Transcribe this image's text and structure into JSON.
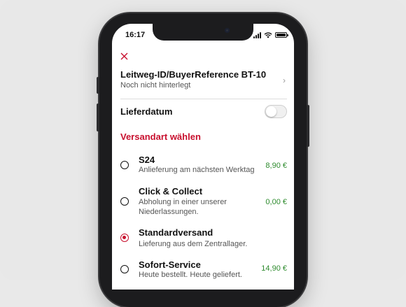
{
  "status_bar": {
    "time": "16:17"
  },
  "header": {
    "close_icon": "close-icon"
  },
  "leitweg": {
    "title": "Leitweg-ID/BuyerReference BT-10",
    "subtitle": "Noch nicht hinterlegt",
    "chevron": "›"
  },
  "lieferdatum": {
    "label": "Lieferdatum",
    "enabled": false
  },
  "versandart": {
    "title": "Versandart wählen",
    "accent_color": "#c8102e",
    "price_color": "#2e8b2e",
    "options": [
      {
        "name": "S24",
        "desc_1": "Anlieferung am nächsten Werktag",
        "desc_2": "",
        "price": "8,90 €",
        "selected": false
      },
      {
        "name": "Click & Collect",
        "desc_1": "Abholung in einer unserer",
        "desc_2": "Niederlassungen.",
        "price": "0,00 €",
        "selected": false
      },
      {
        "name": "Standardversand",
        "desc_1": "Lieferung aus dem Zentrallager.",
        "desc_2": "",
        "price": "",
        "selected": true
      },
      {
        "name": "Sofort-Service",
        "desc_1": "Heute bestellt. Heute geliefert.",
        "desc_2": "",
        "price": "14,90 €",
        "selected": false
      }
    ]
  }
}
